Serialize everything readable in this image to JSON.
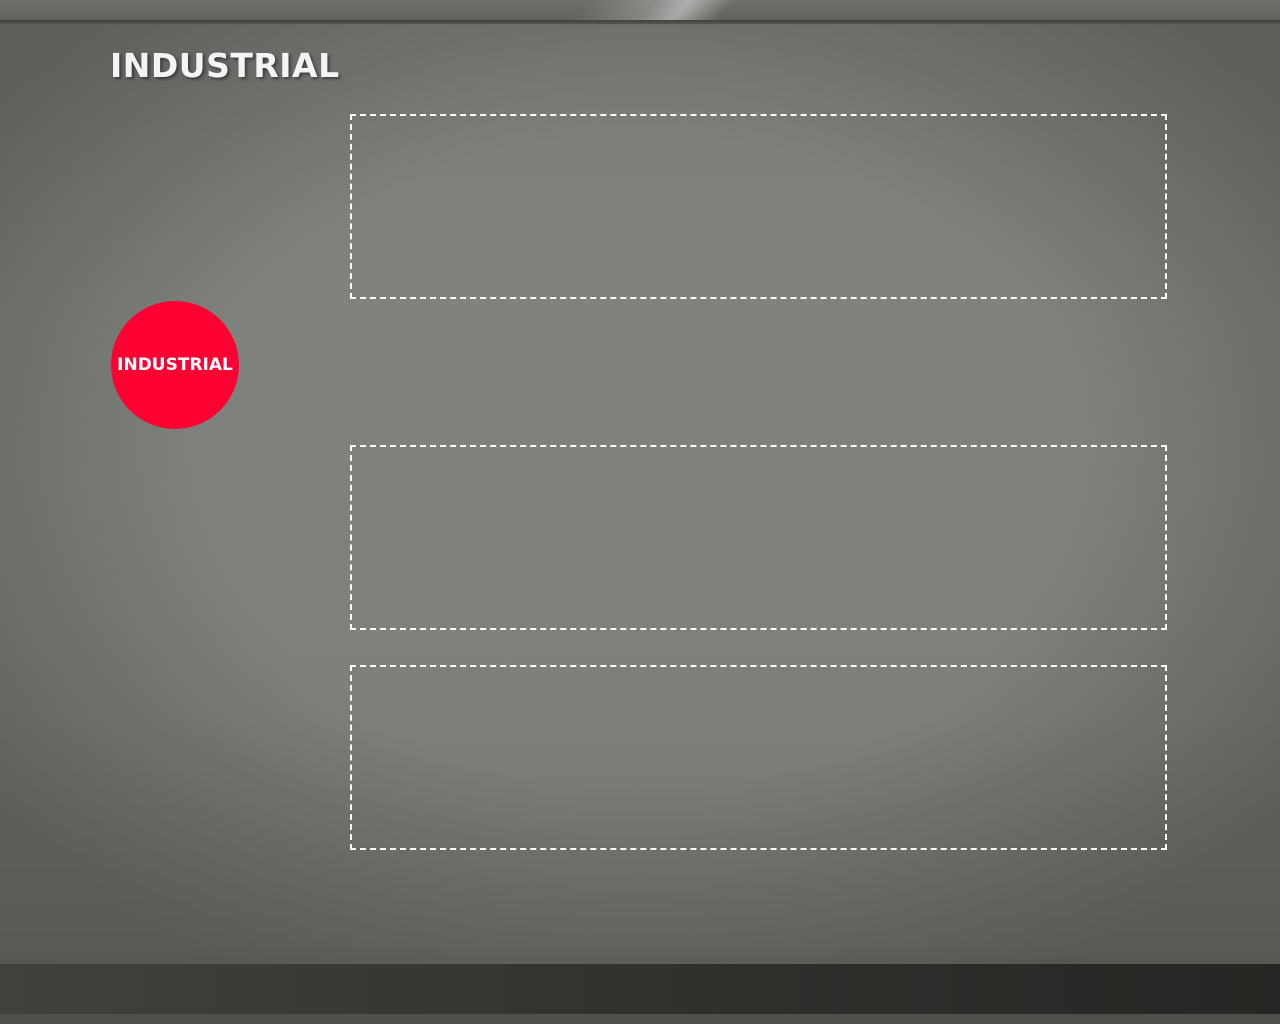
{
  "slide": {
    "title": "INDUSTRIAL",
    "badge_label": "INDUSTRIAL",
    "colors": {
      "background": "#7e807b",
      "badge": "#ff0033",
      "title_text": "#f4f4f4",
      "placeholder_border": "#ffffff",
      "bottom_bar": "#30322e"
    },
    "placeholders": [
      {
        "id": "placeholder-1"
      },
      {
        "id": "placeholder-2"
      },
      {
        "id": "placeholder-3"
      }
    ]
  }
}
